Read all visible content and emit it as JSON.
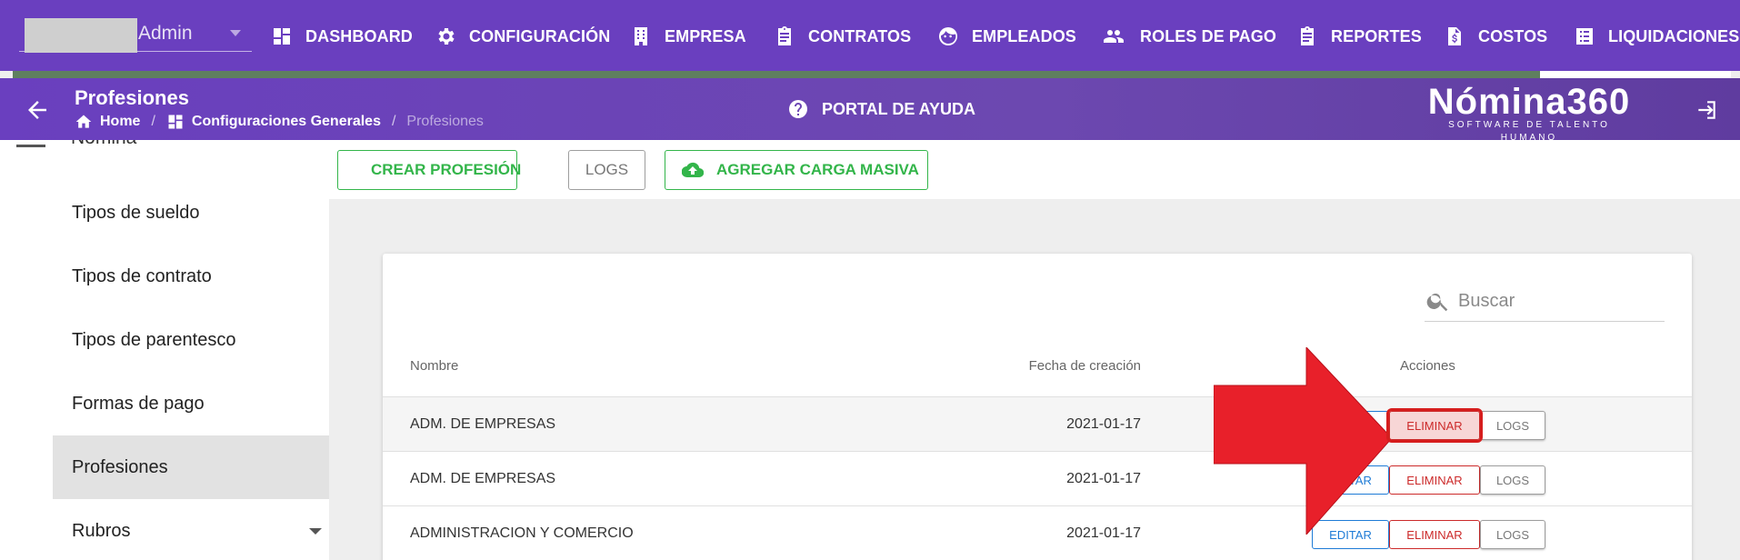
{
  "topnav": {
    "user_name": "Admin",
    "items": [
      {
        "label": "DASHBOARD",
        "icon": "dashboard-icon"
      },
      {
        "label": "CONFIGURACIÓN",
        "icon": "gear-icon"
      },
      {
        "label": "EMPRESA",
        "icon": "building-icon"
      },
      {
        "label": "CONTRATOS",
        "icon": "clipboard-icon"
      },
      {
        "label": "EMPLEADOS",
        "icon": "face-icon"
      },
      {
        "label": "ROLES DE PAGO",
        "icon": "people-icon"
      },
      {
        "label": "REPORTES",
        "icon": "clipboard-icon"
      },
      {
        "label": "COSTOS",
        "icon": "file-dollar-icon"
      },
      {
        "label": "LIQUIDACIONES",
        "icon": "list-icon"
      }
    ]
  },
  "header": {
    "title": "Profesiones",
    "breadcrumb": [
      "Home",
      "Configuraciones Generales",
      "Profesiones"
    ],
    "help_label": "PORTAL DE AYUDA",
    "brand_name": "Nómina360",
    "brand_tagline": "SOFTWARE DE TALENTO HUMANO"
  },
  "sidebar": {
    "section": "Nómina",
    "items": [
      {
        "label": "Tipos de sueldo"
      },
      {
        "label": "Tipos de contrato"
      },
      {
        "label": "Tipos de parentesco"
      },
      {
        "label": "Formas de pago"
      },
      {
        "label": "Profesiones",
        "active": true
      },
      {
        "label": "Rubros",
        "expandable": true
      }
    ]
  },
  "toolbar": {
    "create_label": "CREAR PROFESIÓN",
    "logs_label": "LOGS",
    "bulk_label": "AGREGAR CARGA MASIVA"
  },
  "table": {
    "search_placeholder": "Buscar",
    "columns": {
      "name": "Nombre",
      "date": "Fecha de creación",
      "actions": "Acciones"
    },
    "action_labels": {
      "edit": "EDITAR",
      "delete": "ELIMINAR",
      "logs": "LOGS"
    },
    "rows": [
      {
        "name": "ADM. DE EMPRESAS",
        "date": "2021-01-17"
      },
      {
        "name": "ADM. DE EMPRESAS",
        "date": "2021-01-17"
      },
      {
        "name": "ADMINISTRACION Y COMERCIO",
        "date": "2021-01-17"
      }
    ]
  },
  "colors": {
    "primary_purple": "#6a3fbf",
    "success_green": "#33b54a",
    "danger_red": "#cc2a2a",
    "edit_blue": "#1e7bd6",
    "annotation_red": "#e8202a"
  },
  "annotation": {
    "type": "arrow-pointer",
    "target": "delete-button-row-1",
    "color": "#e8202a"
  }
}
